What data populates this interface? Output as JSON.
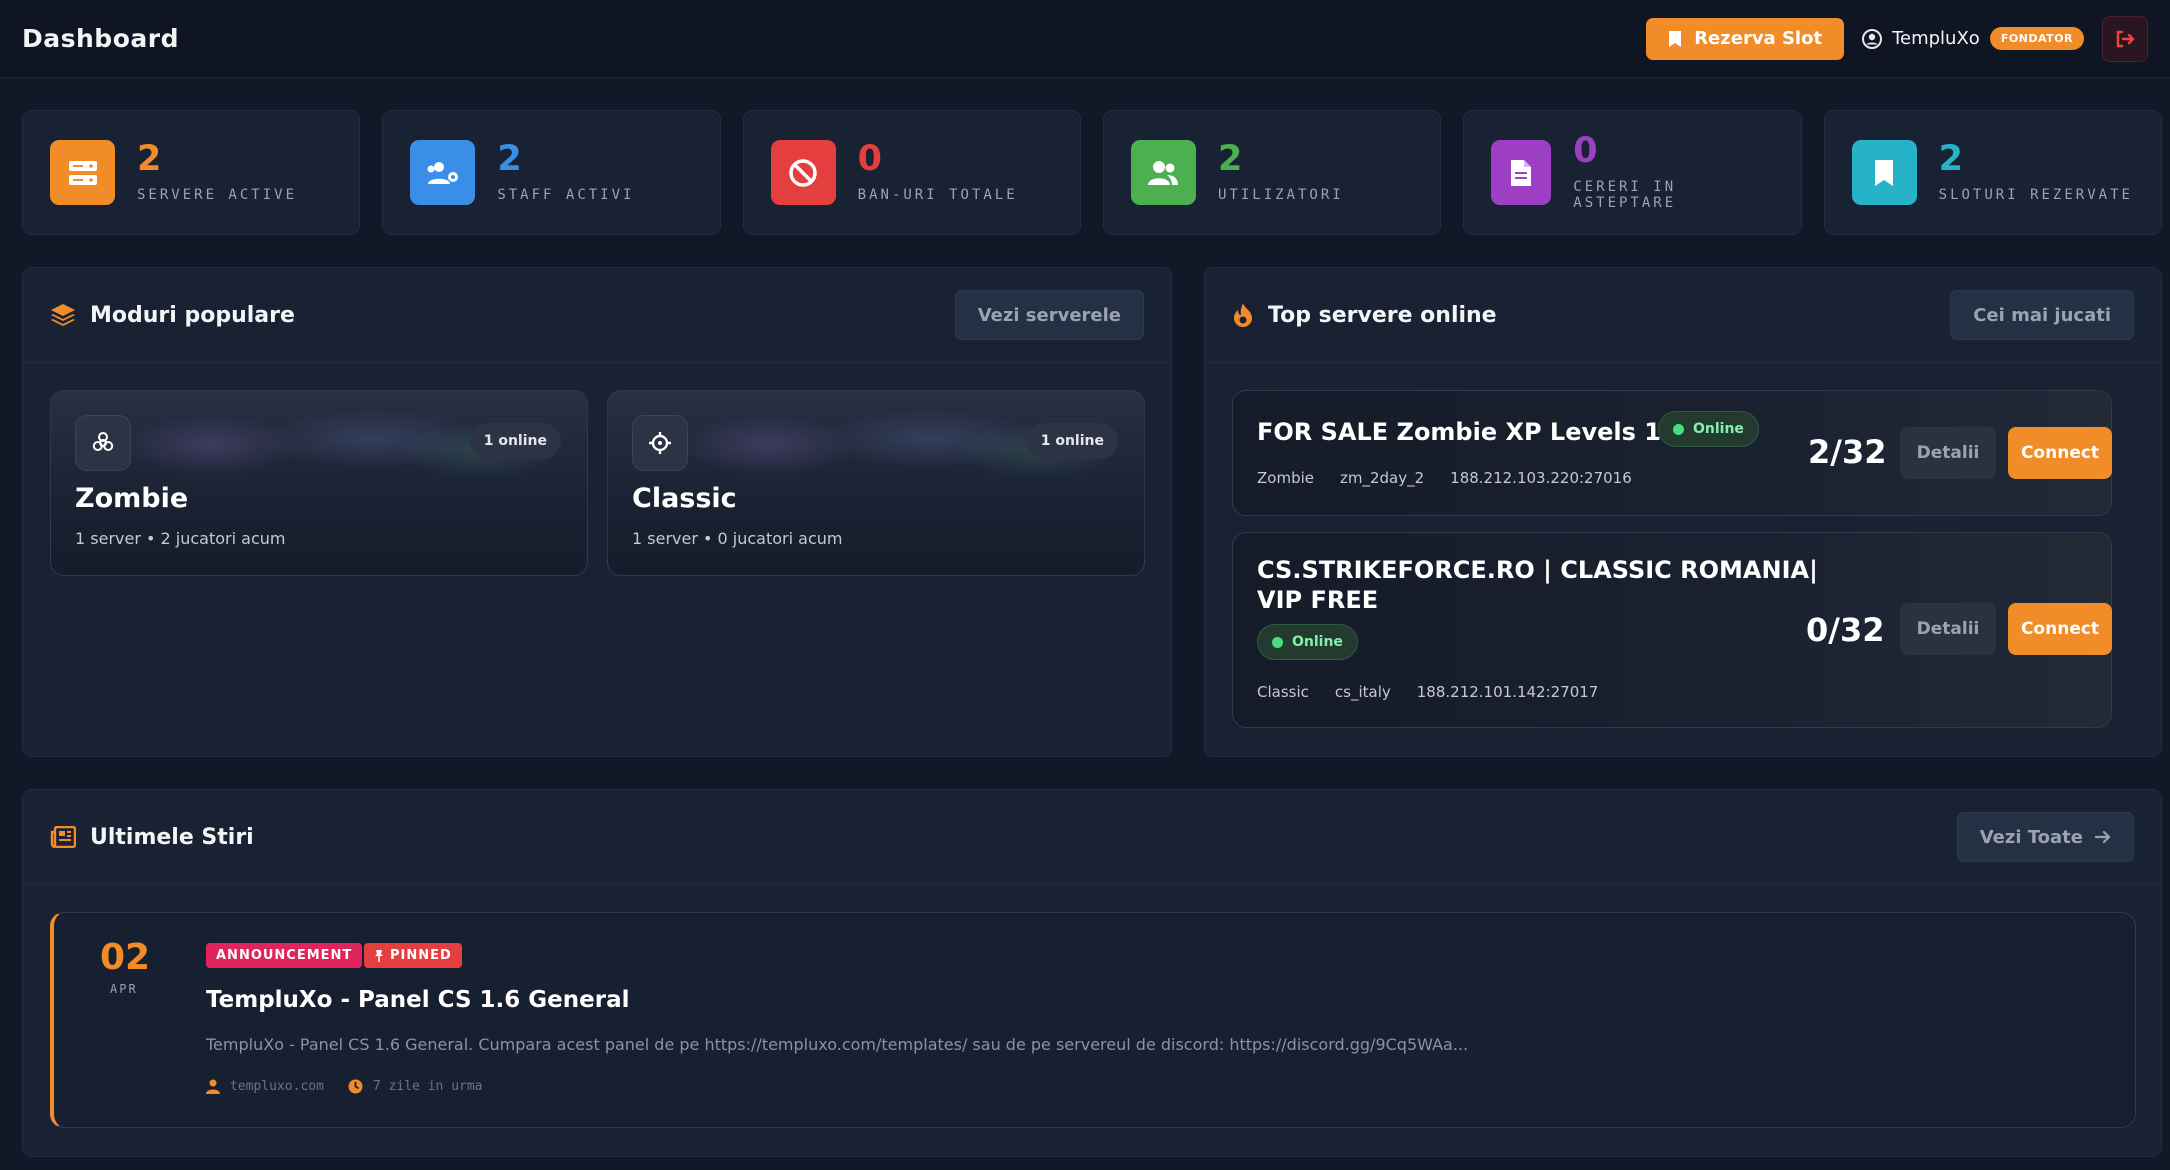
{
  "header": {
    "title": "Dashboard",
    "reserve_label": "Rezerva Slot",
    "user_name": "TempluXo",
    "role": "FONDATOR"
  },
  "stats": [
    {
      "value": "2",
      "label": "SERVERE ACTIVE",
      "color": "#f28c28",
      "icon": "server-icon"
    },
    {
      "value": "2",
      "label": "STAFF ACTIVI",
      "color": "#3b8ee8",
      "icon": "users-cog-icon"
    },
    {
      "value": "0",
      "label": "BAN-URI TOTALE",
      "color": "#e53e3e",
      "icon": "ban-icon"
    },
    {
      "value": "2",
      "label": "UTILIZATORI",
      "color": "#4caf50",
      "icon": "users-icon"
    },
    {
      "value": "0",
      "label": "CERERI IN ASTEPTARE",
      "color": "#9c3fc4",
      "icon": "document-icon"
    },
    {
      "value": "2",
      "label": "SLOTURI REZERVATE",
      "color": "#26b3c7",
      "icon": "bookmark-icon"
    }
  ],
  "modes_panel": {
    "title": "Moduri populare",
    "button": "Vezi serverele",
    "modes": [
      {
        "name": "Zombie",
        "online": "1 online",
        "sub": "1 server • 2 jucatori acum",
        "icon": "biohazard-icon"
      },
      {
        "name": "Classic",
        "online": "1 online",
        "sub": "1 server • 0 jucatori acum",
        "icon": "crosshair-icon"
      }
    ]
  },
  "servers_panel": {
    "title": "Top servere online",
    "button": "Cei mai jucati",
    "details_label": "Detalii",
    "connect_label": "Connect",
    "servers": [
      {
        "name_line1": "FOR SALE Zombie XP Levels 100",
        "name_line2": "",
        "status": "Online",
        "mode": "Zombie",
        "map": "zm_2day_2",
        "ip": "188.212.103.220:27016",
        "players": "2/32"
      },
      {
        "name_line1": "CS.STRIKEFORCE.RO | CLASSIC ROMANIA|",
        "name_line2": "VIP FREE",
        "status": "Online",
        "mode": "Classic",
        "map": "cs_italy",
        "ip": "188.212.101.142:27017",
        "players": "0/32"
      }
    ]
  },
  "news_panel": {
    "title": "Ultimele Stiri",
    "button": "Vezi Toate",
    "item": {
      "day": "02",
      "month": "APR",
      "tags": [
        "ANNOUNCEMENT",
        "PINNED"
      ],
      "title": "TempluXo - Panel CS 1.6 General",
      "excerpt": "TempluXo - Panel CS 1.6 General. Cumpara acest panel de pe https://templuxo.com/templates/ sau de pe servereul de discord: https://discord.gg/9Cq5WAa...",
      "author": "templuxo.com",
      "time": "7 zile in urma"
    }
  }
}
